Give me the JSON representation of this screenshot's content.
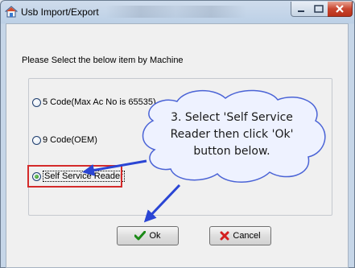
{
  "window": {
    "title": "Usb Import/Export"
  },
  "instruction": "Please Select the below item by Machine",
  "options": [
    {
      "label": "5 Code(Max Ac No is 65535)",
      "checked": false
    },
    {
      "label": "9 Code(OEM)",
      "checked": false
    },
    {
      "label": "Self Service Reader",
      "checked": true
    }
  ],
  "buttons": {
    "ok": "Ok",
    "cancel": "Cancel"
  },
  "callout": {
    "line1": "3. Select 'Self Service",
    "line2": "Reader then click 'Ok'",
    "line3": "button below."
  },
  "colors": {
    "callout_fill": "#eef2ff",
    "callout_border": "#4a63d6",
    "arrow": "#2a45d4",
    "highlight": "#d42a2a"
  }
}
